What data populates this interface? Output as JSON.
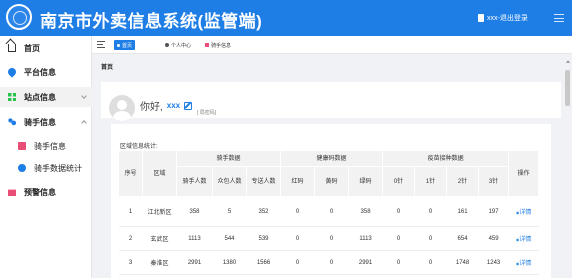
{
  "app": {
    "title": "南京市外卖信息系统(监管端)",
    "logout": "xxx-退出登录"
  },
  "sidebar": {
    "items": [
      {
        "label": "首页",
        "icon": "home-icon"
      },
      {
        "label": "平台信息",
        "icon": "location-pin-icon"
      },
      {
        "label": "站点信息",
        "icon": "grid-icon"
      },
      {
        "label": "骑手信息",
        "icon": "people-icon"
      },
      {
        "label": "骑手信息",
        "icon": "bookmark-icon"
      },
      {
        "label": "骑手数据统计",
        "icon": "pin-icon"
      },
      {
        "label": "预警信息",
        "icon": "warning-icon"
      }
    ]
  },
  "tabs": [
    {
      "label": "首页"
    },
    {
      "label": "个人中心"
    },
    {
      "label": "骑手信息"
    }
  ],
  "page": {
    "heading": "首页"
  },
  "greeting": {
    "hello": "你好,",
    "username": "xxx",
    "change_password": "[ 局密码]"
  },
  "stats": {
    "title": "区域信息统计:",
    "group_headers": [
      "骑手数据",
      "健康码数据",
      "疫苗接种数据"
    ],
    "columns": [
      "序号",
      "区域",
      "骑手人数",
      "众包人数",
      "专送人数",
      "红码",
      "黄码",
      "绿码",
      "0针",
      "1针",
      "2针",
      "3针",
      "操作"
    ],
    "action_label": "详情",
    "rows": [
      [
        "1",
        "江北新区",
        "358",
        "5",
        "352",
        "0",
        "0",
        "358",
        "0",
        "0",
        "161",
        "197"
      ],
      [
        "2",
        "玄武区",
        "1113",
        "544",
        "539",
        "0",
        "0",
        "1113",
        "0",
        "0",
        "654",
        "459"
      ],
      [
        "3",
        "秦淮区",
        "2991",
        "1380",
        "1566",
        "0",
        "0",
        "2991",
        "0",
        "0",
        "1748",
        "1243"
      ]
    ]
  },
  "colors": {
    "primary": "#1f7ee6",
    "header_bg": "#1f7ee6"
  }
}
